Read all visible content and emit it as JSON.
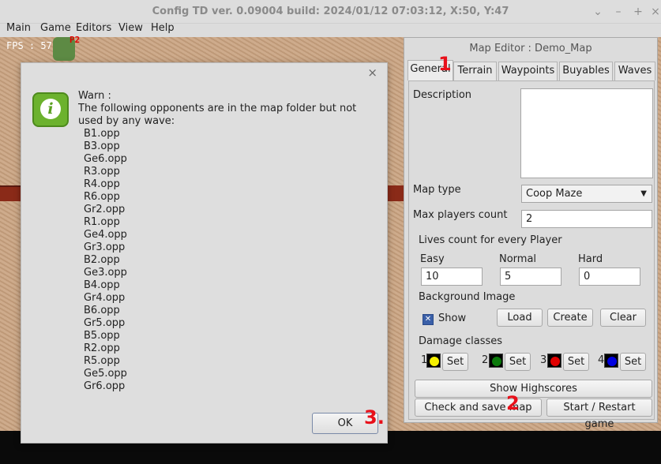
{
  "window": {
    "title": "Config TD ver. 0.09004 build: 2024/01/12  07:03:12, X:50, Y:47"
  },
  "menu": [
    "Main",
    "Game",
    "Editors",
    "View",
    "Help"
  ],
  "game": {
    "fps": "FPS :  57",
    "player_tag": "P2"
  },
  "warn_dialog": {
    "header": "Warn :",
    "text": "The following opponents are in the map folder but not used by any wave:",
    "files": [
      "B1.opp",
      "B3.opp",
      "Ge6.opp",
      "R3.opp",
      "R4.opp",
      "R6.opp",
      "Gr2.opp",
      "R1.opp",
      "Ge4.opp",
      "Gr3.opp",
      "B2.opp",
      "Ge3.opp",
      "B4.opp",
      "Gr4.opp",
      "B6.opp",
      "Gr5.opp",
      "B5.opp",
      "R2.opp",
      "R5.opp",
      "Ge5.opp",
      "Gr6.opp"
    ],
    "ok_label": "OK"
  },
  "map_editor": {
    "title": "Map Editor : Demo_Map",
    "tabs": [
      "General",
      "Terrain",
      "Waypoints",
      "Buyables",
      "Waves"
    ],
    "description_label": "Description",
    "map_type_label": "Map type",
    "map_type_value": "Coop Maze",
    "max_players_label": "Max players count",
    "max_players_value": "2",
    "lives_label": "Lives count for every Player",
    "lives": {
      "easy_label": "Easy",
      "easy_value": "10",
      "normal_label": "Normal",
      "normal_value": "5",
      "hard_label": "Hard",
      "hard_value": "0"
    },
    "bg_label": "Background Image",
    "show_label": "Show",
    "load_label": "Load",
    "create_label": "Create",
    "clear_label": "Clear",
    "damage_label": "Damage classes",
    "damage_classes": [
      {
        "num": "1",
        "color": "#f5f000",
        "set": "Set"
      },
      {
        "num": "2",
        "color": "#0b7a0b",
        "set": "Set"
      },
      {
        "num": "3",
        "color": "#e00000",
        "set": "Set"
      },
      {
        "num": "4",
        "color": "#0000e0",
        "set": "Set"
      }
    ],
    "show_highscores": "Show Highscores",
    "check_save": "Check and save map",
    "start_restart": "Start / Restart game"
  },
  "annotations": [
    "1",
    "2",
    "3."
  ]
}
